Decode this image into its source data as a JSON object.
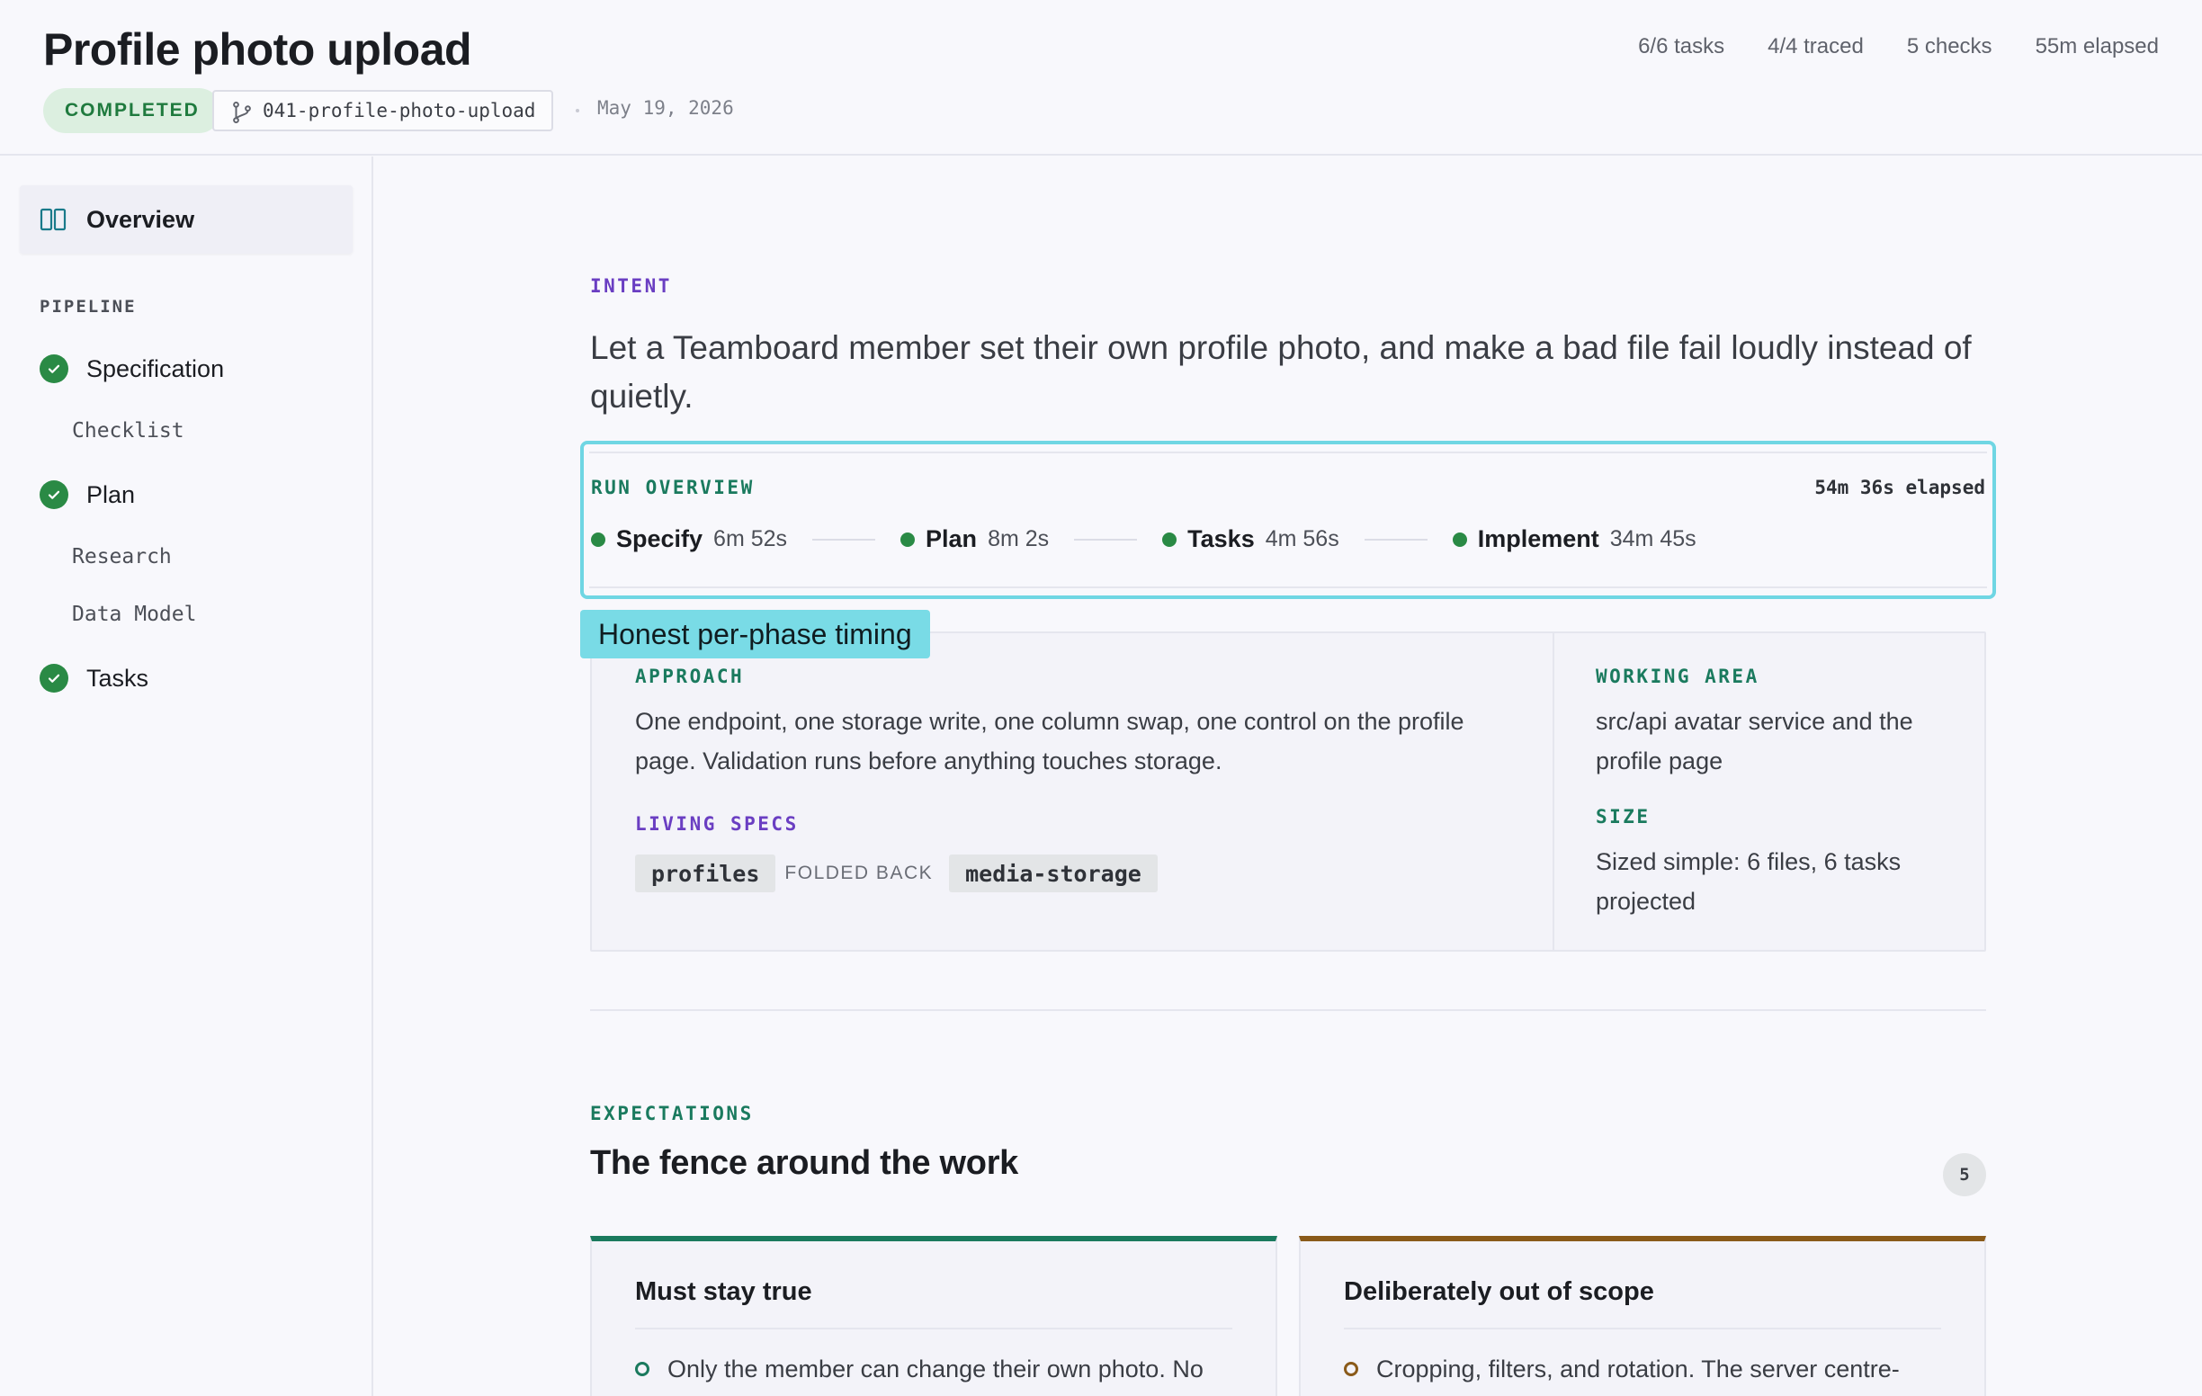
{
  "header": {
    "title": "Profile photo upload",
    "status": "COMPLETED",
    "branch": "041-profile-photo-upload",
    "date": "May 19, 2026",
    "stats": [
      "6/6 tasks",
      "4/4 traced",
      "5 checks",
      "55m elapsed"
    ]
  },
  "sidebar": {
    "overview": "Overview",
    "pipeline_label": "PIPELINE",
    "steps": [
      {
        "label": "Specification",
        "subs": [
          "Checklist"
        ]
      },
      {
        "label": "Plan",
        "subs": [
          "Research",
          "Data Model"
        ]
      },
      {
        "label": "Tasks",
        "subs": []
      }
    ]
  },
  "intent": {
    "label": "INTENT",
    "text": "Let a Teamboard member set their own profile photo, and make a bad file fail loudly instead of quietly."
  },
  "run_overview": {
    "label": "RUN OVERVIEW",
    "elapsed": "54m 36s elapsed",
    "phases": [
      {
        "name": "Specify",
        "time": "6m 52s"
      },
      {
        "name": "Plan",
        "time": "8m 2s"
      },
      {
        "name": "Tasks",
        "time": "4m 56s"
      },
      {
        "name": "Implement",
        "time": "34m 45s"
      }
    ],
    "callout": "Honest per-phase timing"
  },
  "approach": {
    "label": "APPROACH",
    "text": "One endpoint, one storage write, one column swap, one control on the profile page. Validation runs before anything touches storage.",
    "living_specs_label": "LIVING SPECS",
    "spec_a": "profiles",
    "folded_back": "FOLDED BACK",
    "spec_b": "media-storage",
    "working_area_label": "WORKING AREA",
    "working_area": "src/api avatar service and the profile page",
    "size_label": "SIZE",
    "size": "Sized simple: 6 files, 6 tasks projected"
  },
  "expectations": {
    "label": "EXPECTATIONS",
    "title": "The fence around the work",
    "count": "5",
    "must_title": "Must stay true",
    "must_item": "Only the member can change their own photo. No",
    "scope_title": "Deliberately out of scope",
    "scope_item": "Cropping, filters, and rotation. The server centre-"
  },
  "colors": {
    "accent_teal": "#6fd6e3",
    "success_green": "#2a8a45",
    "intent_purple": "#6a3ec2",
    "label_green": "#1a7a5e",
    "scope_brown": "#8a5a1a"
  }
}
